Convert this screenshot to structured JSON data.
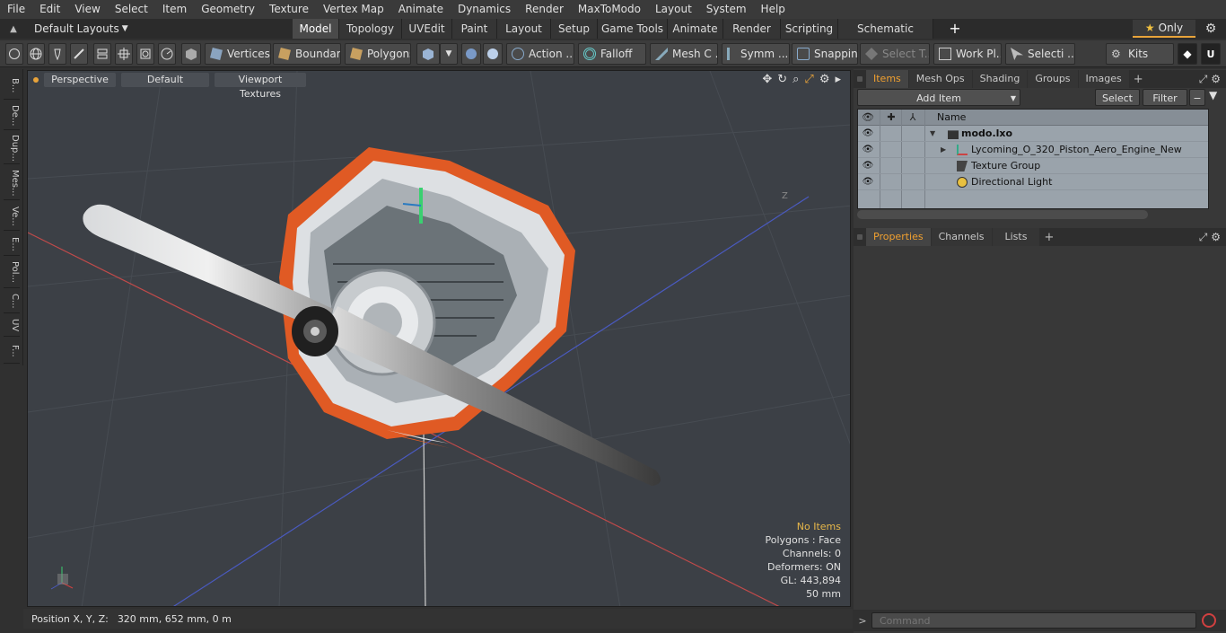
{
  "menu": [
    "File",
    "Edit",
    "View",
    "Select",
    "Item",
    "Geometry",
    "Texture",
    "Vertex Map",
    "Animate",
    "Dynamics",
    "Render",
    "MaxToModo",
    "Layout",
    "System",
    "Help"
  ],
  "layout": {
    "name": "Default Layouts"
  },
  "tabs": [
    {
      "label": "Model",
      "active": true
    },
    {
      "label": "Topology"
    },
    {
      "label": "UVEdit"
    },
    {
      "label": "Paint"
    },
    {
      "label": "Layout"
    },
    {
      "label": "Setup"
    },
    {
      "label": "Game Tools"
    },
    {
      "label": "Animate"
    },
    {
      "label": "Render"
    },
    {
      "label": "Scripting"
    },
    {
      "label": "Schematic Fusion"
    }
  ],
  "topright": {
    "only_label": "Only"
  },
  "toolbar": {
    "vertices": "Vertices",
    "boundary": "Boundary",
    "polygons": "Polygons",
    "action": "Action ...",
    "falloff": "Falloff",
    "mesh": "Mesh C ...",
    "symm": "Symm ...",
    "snapping": "Snapping",
    "select_t": "Select T...",
    "work_pl": "Work Pl...",
    "selecti": "Selecti ...",
    "kits": "Kits"
  },
  "left_tabs": [
    "B...",
    "De...",
    "Dup...",
    "Mes...",
    "Ve...",
    "E...",
    "Pol...",
    "C...",
    "UV",
    "F..."
  ],
  "viewport": {
    "view_mode": "Perspective",
    "shading": "Default",
    "textures": "Viewport Textures",
    "axis_label": "Z",
    "info": {
      "items": "No Items",
      "polygons": "Polygons : Face",
      "channels": "Channels: 0",
      "deformers": "Deformers: ON",
      "gl": "GL: 443,894",
      "scale": "50 mm"
    }
  },
  "status": {
    "label": "Position X, Y, Z:",
    "value": "320 mm, 652 mm, 0 m"
  },
  "items_panel": {
    "tabs": [
      {
        "label": "Items",
        "active": true
      },
      {
        "label": "Mesh Ops"
      },
      {
        "label": "Shading"
      },
      {
        "label": "Groups"
      },
      {
        "label": "Images"
      }
    ],
    "add_item": "Add Item",
    "select": "Select",
    "filter": "Filter",
    "name_header": "Name",
    "rows": [
      {
        "label": "modo.lxo"
      },
      {
        "label": "Lycoming_O_320_Piston_Aero_Engine_New"
      },
      {
        "label": "Texture Group"
      },
      {
        "label": "Directional Light"
      }
    ]
  },
  "props_panel": {
    "tabs": [
      {
        "label": "Properties",
        "active": true
      },
      {
        "label": "Channels"
      },
      {
        "label": "Lists"
      }
    ]
  },
  "command": {
    "placeholder": "Command"
  },
  "colors": {
    "accent": "#e8a33a",
    "engine_orange": "#e0521e",
    "viewport_bg": "#3c4046",
    "list_bg": "#9aa3ab"
  }
}
